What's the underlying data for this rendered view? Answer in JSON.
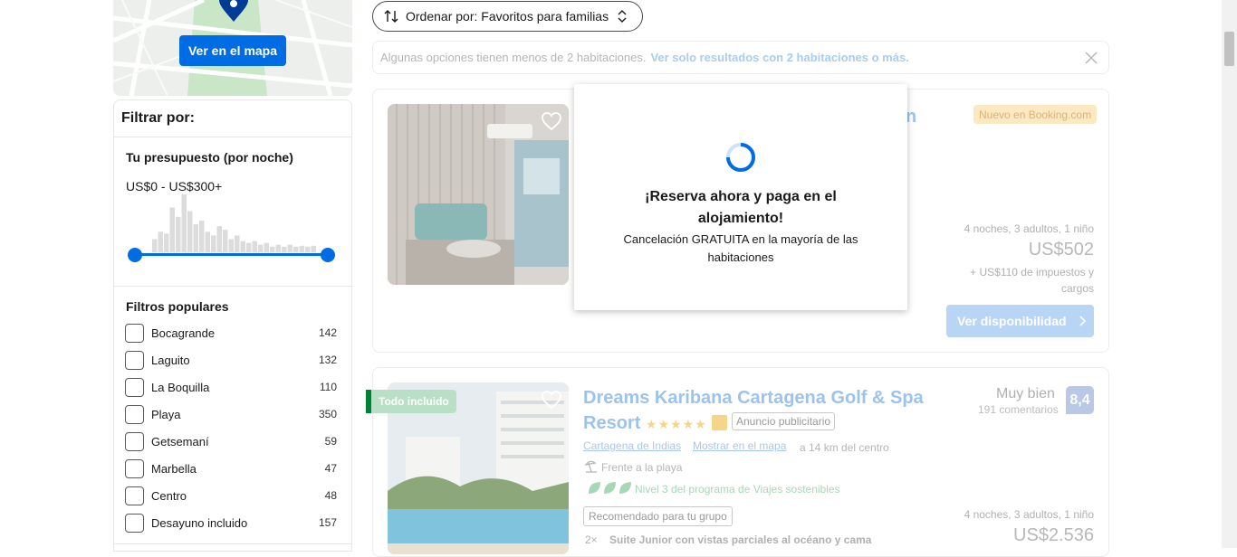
{
  "map": {
    "button_label": "Ver en el mapa"
  },
  "filters": {
    "title": "Filtrar por:",
    "budget_title": "Tu presupuesto (por noche)",
    "budget_range": "US$0 - US$300+",
    "popular_title": "Filtros populares",
    "items": [
      {
        "label": "Bocagrande",
        "count": "142"
      },
      {
        "label": "Laguito",
        "count": "132"
      },
      {
        "label": "La Boquilla",
        "count": "110"
      },
      {
        "label": "Playa",
        "count": "350"
      },
      {
        "label": "Getsemaní",
        "count": "59"
      },
      {
        "label": "Marbella",
        "count": "47"
      },
      {
        "label": "Centro",
        "count": "48"
      },
      {
        "label": "Desayuno incluido",
        "count": "157"
      }
    ]
  },
  "sort": {
    "label": "Ordenar por: Favoritos para familias"
  },
  "notice": {
    "text": "Algunas opciones tienen menos de 2 habitaciones.",
    "link": "Ver solo resultados con 2 habitaciones o más."
  },
  "card1": {
    "badge": "Nuevo en Booking.com",
    "title_fragment": "n",
    "stay": "4 noches, 3 adultos, 1 niño",
    "price": "US$502",
    "taxes": "+ US$110 de impuestos y cargos",
    "button": "Ver disponibilidad"
  },
  "card2": {
    "badge": "Todo incluido",
    "title": "Dreams Karibana Cartagena Golf & Spa Resort",
    "stars": 5,
    "ad": "Anuncio publicitario",
    "location": "Cartagena de Indias",
    "map_link": "Mostrar en el mapa",
    "distance": "a 14 km del centro",
    "beach": "Frente a la playa",
    "sustainable": "Nivel 3 del programa de Viajes sostenibles",
    "recommended": "Recomendado para tu grupo",
    "room_qty": "2×",
    "room": "Suite Junior con vistas parciales al océano y cama",
    "rating_word": "Muy bien",
    "rating_count": "191 comentarios",
    "score": "8,4",
    "stay": "4 noches, 3 adultos, 1 niño",
    "price": "US$2.536"
  },
  "modal": {
    "title": "¡Reserva ahora y paga en el alojamiento!",
    "subtitle": "Cancelación GRATUITA en la mayoría de las habitaciones"
  },
  "colors": {
    "primary": "#006ce4",
    "green": "#008234"
  },
  "histogram": [
    14,
    22,
    20,
    48,
    38,
    62,
    44,
    30,
    34,
    22,
    18,
    28,
    24,
    14,
    18,
    12,
    10,
    12,
    8,
    10,
    6,
    8,
    6,
    8,
    6,
    7,
    6,
    7
  ]
}
